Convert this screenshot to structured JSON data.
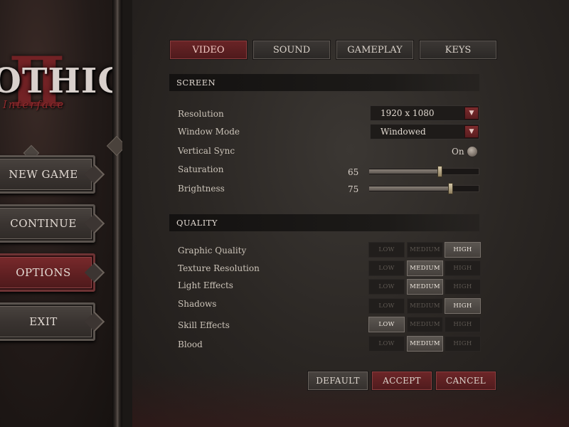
{
  "logo": {
    "title": "OTHIC",
    "numeral": "II",
    "subtitle": "r Interface"
  },
  "main_menu": {
    "items": [
      {
        "label": "NEW GAME"
      },
      {
        "label": "CONTINUE"
      },
      {
        "label": "OPTIONS",
        "active": true
      },
      {
        "label": "EXIT"
      }
    ]
  },
  "tabs": [
    {
      "label": "VIDEO",
      "active": true
    },
    {
      "label": "SOUND"
    },
    {
      "label": "GAMEPLAY"
    },
    {
      "label": "KEYS"
    }
  ],
  "screen": {
    "header": "SCREEN",
    "resolution": {
      "label": "Resolution",
      "value": "1920 x 1080"
    },
    "window_mode": {
      "label": "Window Mode",
      "value": "Windowed"
    },
    "vsync": {
      "label": "Vertical Sync",
      "value": "On"
    },
    "saturation": {
      "label": "Saturation",
      "value": "65",
      "level": 0.65
    },
    "brightness": {
      "label": "Brightness",
      "value": "75",
      "level": 0.75
    }
  },
  "quality": {
    "header": "QUALITY",
    "levels": [
      "LOW",
      "MEDIUM",
      "HIGH"
    ],
    "rows": [
      {
        "label": "Graphic Quality",
        "selected": "HIGH"
      },
      {
        "label": "Texture Resolution",
        "selected": "MEDIUM"
      },
      {
        "label": "Light Effects",
        "selected": "MEDIUM"
      },
      {
        "label": "Shadows",
        "selected": "HIGH"
      },
      {
        "label": "Skill Effects",
        "selected": "LOW"
      },
      {
        "label": "Blood",
        "selected": "MEDIUM"
      }
    ]
  },
  "footer": {
    "default_label": "DEFAULT",
    "accept_label": "ACCEPT",
    "cancel_label": "CANCEL"
  },
  "colors": {
    "accent_red": "#6e2628",
    "panel_dark": "#1e1b19",
    "selected_gray": "#5b5651"
  }
}
